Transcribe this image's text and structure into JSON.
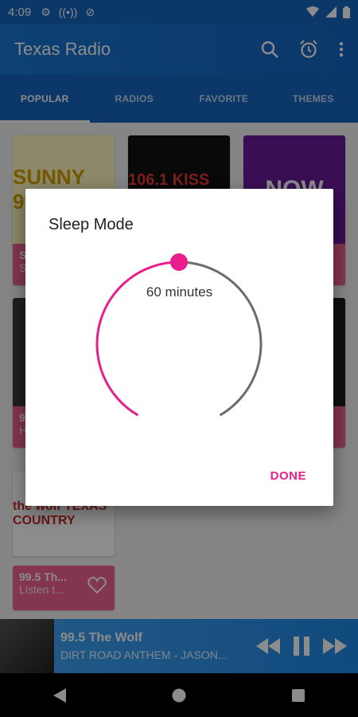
{
  "status_bar": {
    "time": "4:09"
  },
  "app_bar": {
    "title": "Texas Radio"
  },
  "tabs": [
    {
      "label": "POPULAR",
      "active": true
    },
    {
      "label": "RADIOS",
      "active": false
    },
    {
      "label": "FAVORITE",
      "active": false
    },
    {
      "label": "THEMES",
      "active": false
    }
  ],
  "cards": [
    {
      "art_text": "SUNNY 99.1",
      "name": "S",
      "subtitle": "S"
    },
    {
      "art_text": "106.1 KISS FM",
      "name": "",
      "subtitle": ""
    },
    {
      "art_text": "NOW",
      "name": "",
      "subtitle": ""
    },
    {
      "art_text": "",
      "name": "97",
      "subtitle": "H"
    },
    {
      "art_text": "",
      "name": "",
      "subtitle": ""
    },
    {
      "art_text": "",
      "name": "",
      "subtitle": ""
    },
    {
      "art_text": "the wolf TEXAS COUNTRY",
      "name": "99.5 Th...",
      "subtitle": "Listen t..."
    }
  ],
  "mini_player": {
    "title": "99.5 The Wolf",
    "subtitle": "DIRT ROAD ANTHEM - JASON..."
  },
  "dialog": {
    "title": "Sleep Mode",
    "value_label": "60 minutes",
    "done_label": "DONE"
  },
  "colors": {
    "primary": "#1565c0",
    "accent": "#e91e8c",
    "card_info": "#f06292"
  },
  "icons": {
    "app_bar": [
      "search-icon",
      "alarm-icon",
      "more-vert-icon"
    ],
    "mini_player": [
      "rewind-icon",
      "pause-icon",
      "fast-forward-icon"
    ],
    "nav": [
      "back-icon",
      "home-icon",
      "recents-icon"
    ]
  }
}
